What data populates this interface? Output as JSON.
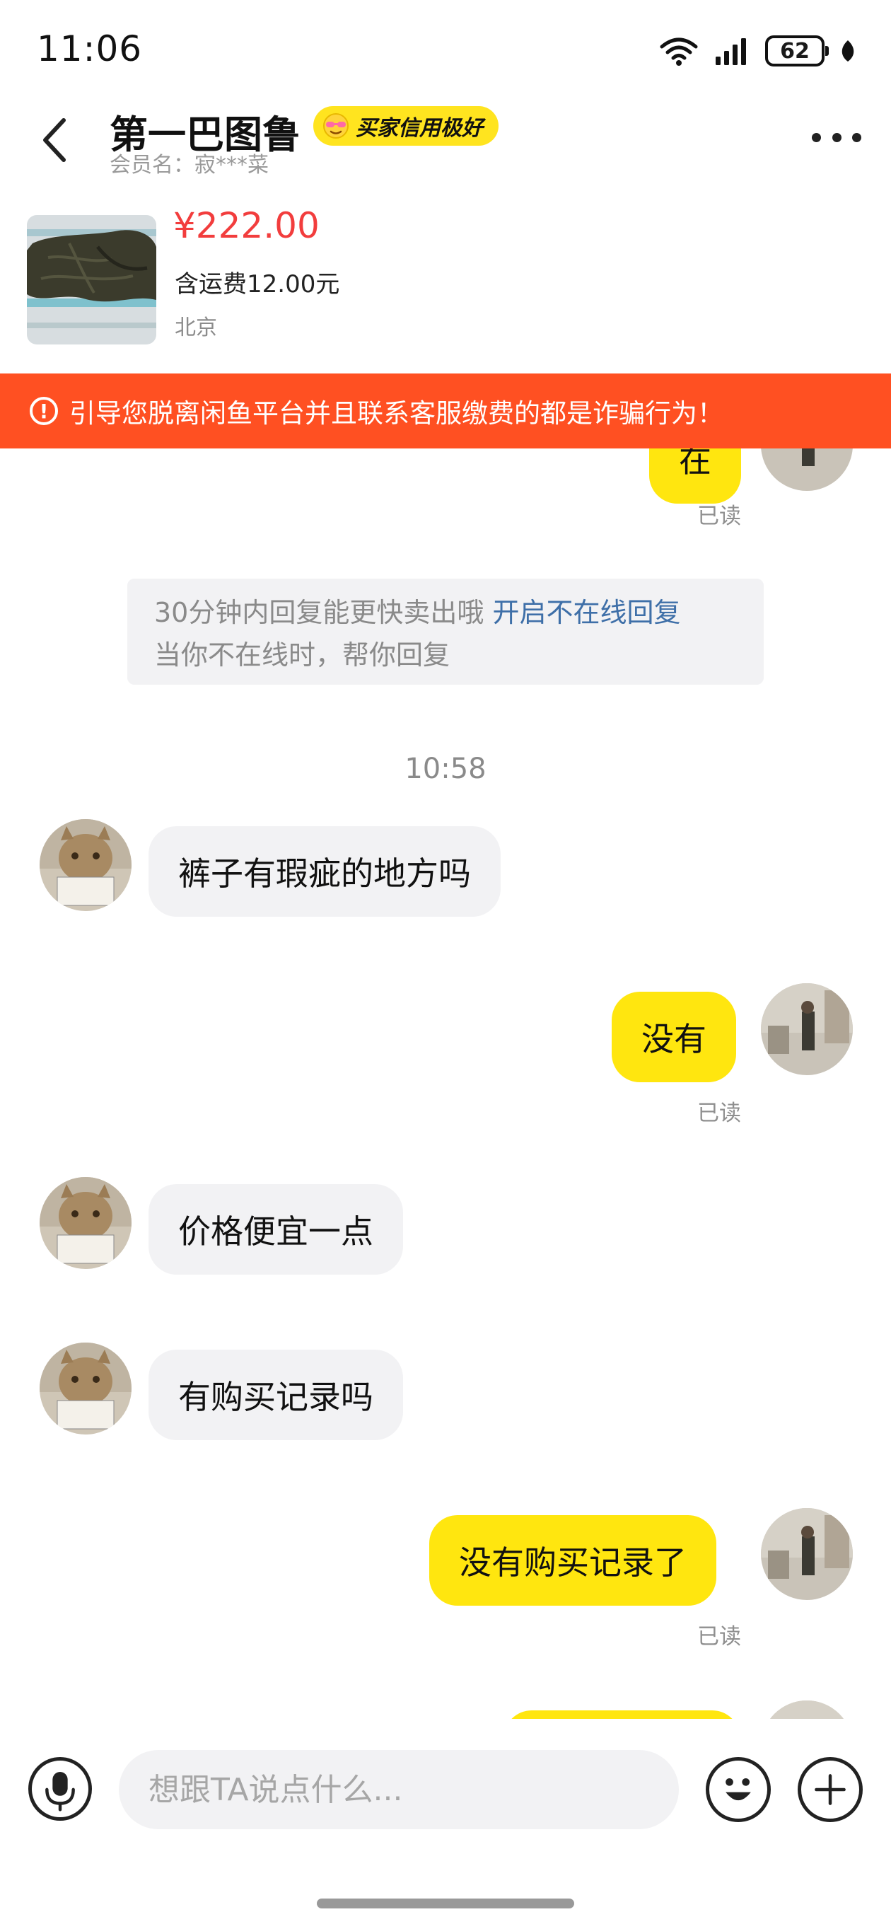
{
  "status_bar": {
    "time": "11:06",
    "battery": "62"
  },
  "header": {
    "title": "第一巴图鲁",
    "credit_badge": "买家信用极好",
    "member_label": "会员名：",
    "member_name": "寂***菜"
  },
  "product": {
    "price": "¥222.00",
    "shipping": "含运费12.00元",
    "location": "北京"
  },
  "warning": {
    "text": "引导您脱离闲鱼平台并且联系客服缴费的都是诈骗行为！"
  },
  "chat": {
    "partial_top_bubble": "在",
    "read_label": "已读",
    "notice": {
      "text": "30分钟内回复能更快卖出哦",
      "link": "开启不在线回复",
      "subtext": "当你不在线时，帮你回复"
    },
    "timestamp": "10:58",
    "messages": [
      {
        "from": "them",
        "text": "裤子有瑕疵的地方吗"
      },
      {
        "from": "me",
        "text": "没有",
        "status": "已读"
      },
      {
        "from": "them",
        "text": "价格便宜一点"
      },
      {
        "from": "them",
        "text": "有购买记录吗"
      },
      {
        "from": "me",
        "text": "没有购买记录了",
        "status": "已读"
      }
    ]
  },
  "input": {
    "placeholder": "想跟TA说点什么..."
  }
}
